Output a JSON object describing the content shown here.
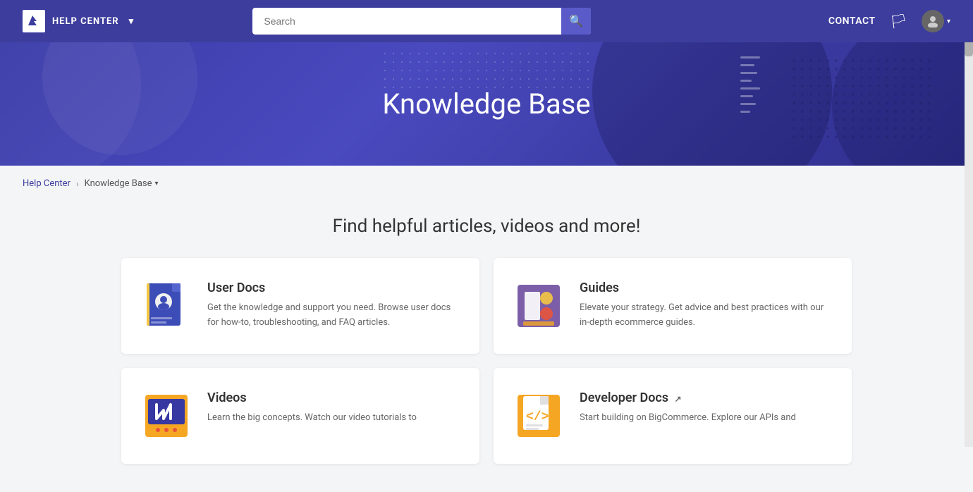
{
  "navbar": {
    "logo_text": "HELP CENTER",
    "logo_arrow": "▾",
    "search_placeholder": "Search",
    "contact_label": "CONTACT",
    "avatar_arrow": "▾"
  },
  "hero": {
    "title": "Knowledge Base"
  },
  "breadcrumb": {
    "home": "Help Center",
    "current": "Knowledge Base",
    "separator": "›",
    "arrow": "▾"
  },
  "main": {
    "tagline": "Find helpful articles, videos and more!",
    "cards": [
      {
        "id": "user-docs",
        "title": "User Docs",
        "description": "Get the knowledge and support you need. Browse user docs for how-to, troubleshooting, and FAQ articles."
      },
      {
        "id": "guides",
        "title": "Guides",
        "description": "Elevate your strategy. Get advice and best practices with our in-depth ecommerce guides."
      },
      {
        "id": "videos",
        "title": "Videos",
        "description": "Learn the big concepts. Watch our video tutorials to"
      },
      {
        "id": "developer-docs",
        "title": "Developer Docs",
        "description": "Start building on BigCommerce. Explore our APIs and",
        "external": true,
        "external_icon": "↗"
      }
    ]
  }
}
